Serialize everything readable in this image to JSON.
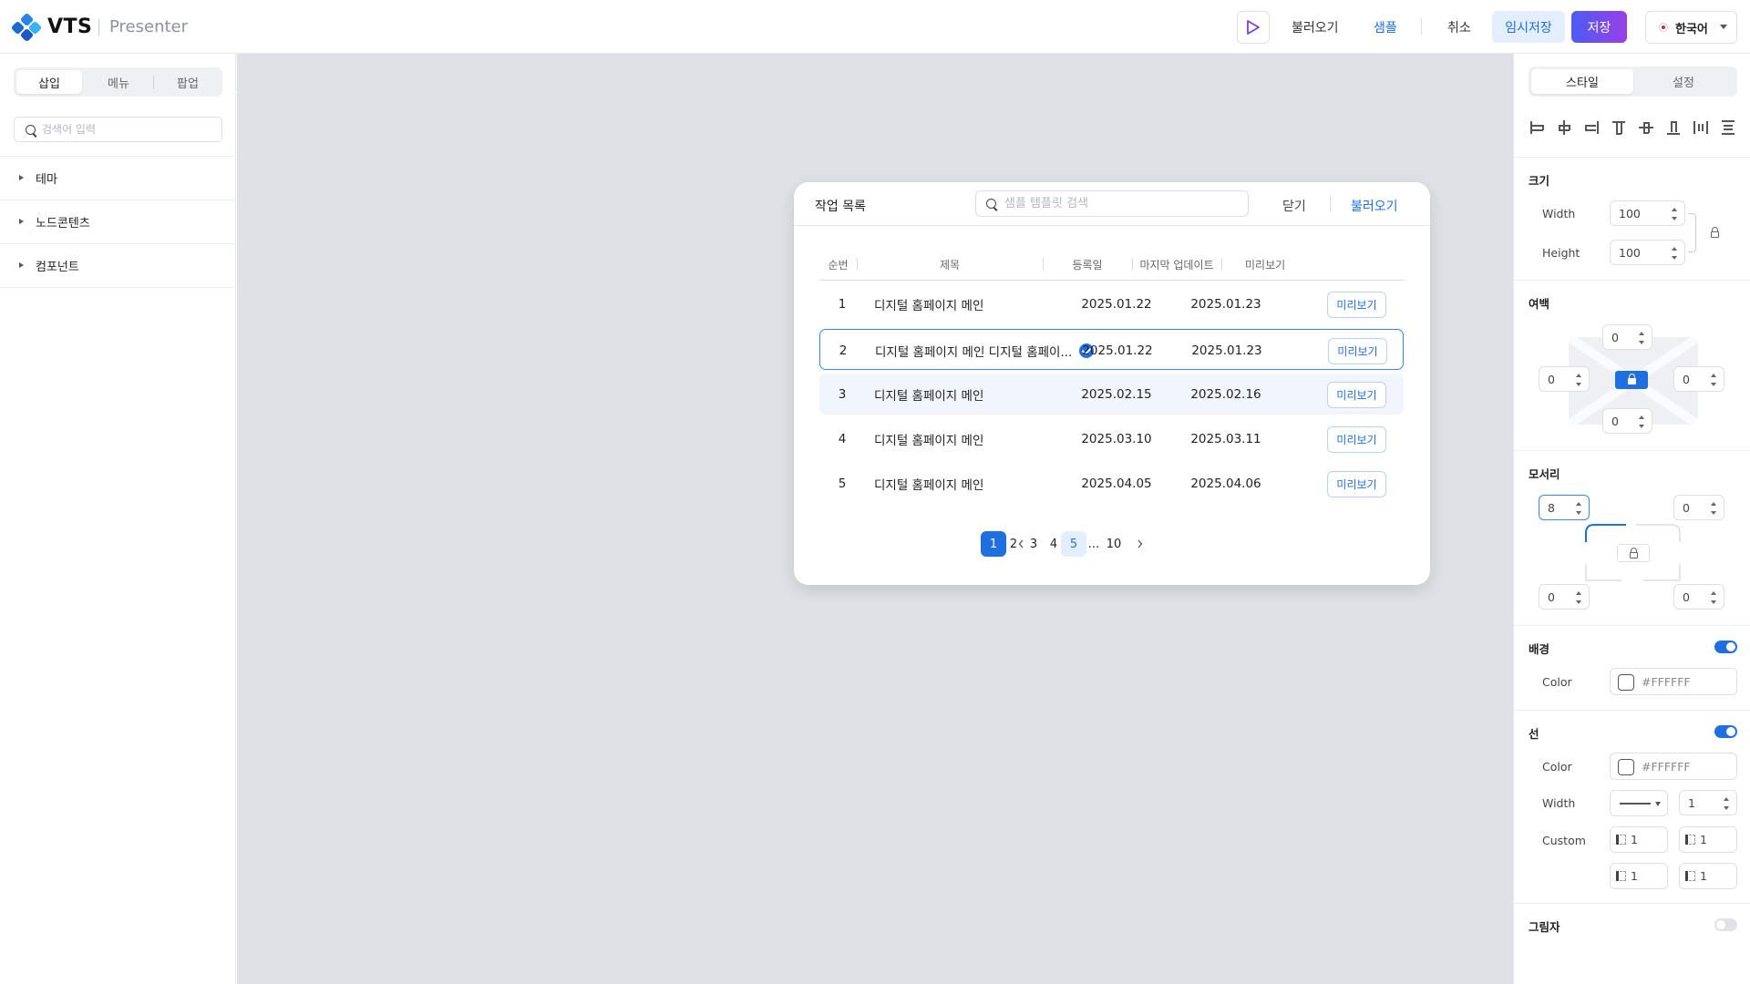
{
  "header": {
    "brand": "VTS",
    "product": "Presenter",
    "links": {
      "load": "불러오기",
      "sample": "샘플",
      "cancel": "취소"
    },
    "temp_save": "임시저장",
    "save": "저장",
    "language": "한국어"
  },
  "left_panel": {
    "tabs": [
      "삽입",
      "메뉴",
      "팝업"
    ],
    "search_placeholder": "검색어 입력",
    "tree": [
      "테마",
      "노드콘텐츠",
      "컴포넌트"
    ]
  },
  "modal": {
    "title": "작업 목록",
    "search_placeholder": "샘플 템플릿 검색",
    "close": "닫기",
    "load": "불러오기",
    "columns": [
      "순번",
      "제목",
      "등록일",
      "마지막 업데이트",
      "미리보기"
    ],
    "rows": [
      {
        "no": "1",
        "title": "디지털 홈페이지 메인",
        "created": "2025.01.22",
        "updated": "2025.01.23",
        "preview": "미리보기"
      },
      {
        "no": "2",
        "title": "디지털 홈페이지 메인 디지털 홈페이...",
        "created": "2025.01.22",
        "updated": "2025.01.23",
        "preview": "미리보기"
      },
      {
        "no": "3",
        "title": "디지털 홈페이지 메인",
        "created": "2025.02.15",
        "updated": "2025.02.16",
        "preview": "미리보기"
      },
      {
        "no": "4",
        "title": "디지털 홈페이지 메인",
        "created": "2025.03.10",
        "updated": "2025.03.11",
        "preview": "미리보기"
      },
      {
        "no": "5",
        "title": "디지털 홈페이지 메인",
        "created": "2025.04.05",
        "updated": "2025.04.06",
        "preview": "미리보기"
      }
    ],
    "selected_row": 2,
    "pagination": {
      "pages": [
        "1",
        "2",
        "3",
        "4",
        "5",
        "...",
        "10"
      ],
      "current": "1",
      "highlighted": "5"
    }
  },
  "right_panel": {
    "tabs": [
      "스타일",
      "설정"
    ],
    "size": {
      "title": "크기",
      "width_label": "Width",
      "width": "100",
      "height_label": "Height",
      "height": "100"
    },
    "margin": {
      "title": "여백",
      "top": "0",
      "left": "0",
      "right": "0",
      "bottom": "0"
    },
    "corner": {
      "title": "모서리",
      "top_left": "8",
      "top_right": "0",
      "bottom_left": "0",
      "bottom_right": "0"
    },
    "background": {
      "title": "배경",
      "color_label": "Color",
      "color": "#FFFFFF",
      "enabled": true
    },
    "border": {
      "title": "선",
      "color_label": "Color",
      "color": "#FFFFFF",
      "width_label": "Width",
      "width": "1",
      "custom_label": "Custom",
      "custom": [
        "1",
        "1",
        "1",
        "1"
      ],
      "enabled": true
    },
    "shadow": {
      "title": "그림자",
      "enabled": false
    }
  },
  "colors": {
    "accent": "#1F6FE0",
    "save_gradient_start": "#4B5CF2",
    "save_gradient_end": "#9A3FE8",
    "canvas": "#DFE1E6"
  }
}
